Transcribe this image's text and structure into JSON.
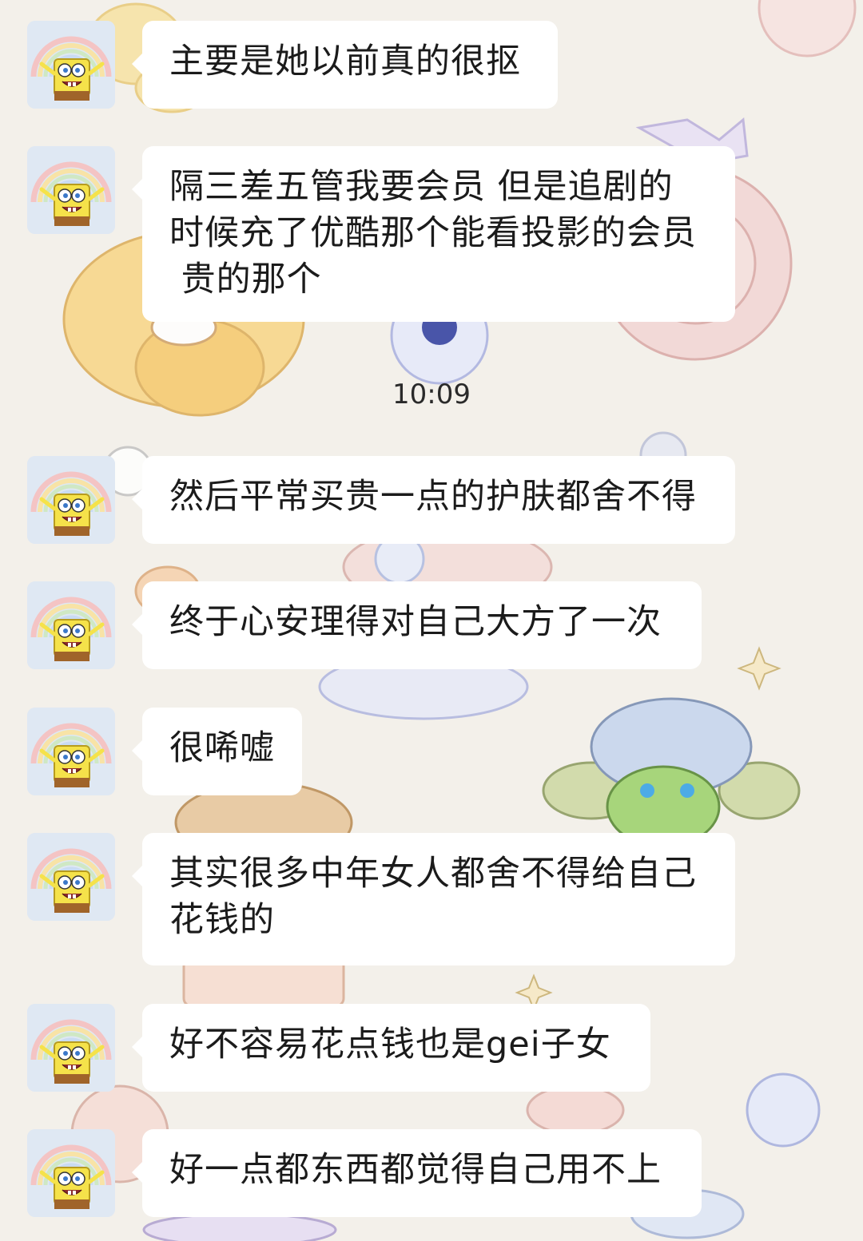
{
  "chat": {
    "timestamp": "10:09",
    "messages": [
      {
        "text": "主要是她以前真的很抠",
        "avatar": "spongebob-avatar"
      },
      {
        "text": "隔三差五管我要会员 但是追剧的\n时候充了优酷那个能看投影的会员\n 贵的那个",
        "avatar": "spongebob-avatar"
      },
      {
        "text": "然后平常买贵一点的护肤都舍不得",
        "avatar": "spongebob-avatar"
      },
      {
        "text": "终于心安理得对自己大方了一次",
        "avatar": "spongebob-avatar"
      },
      {
        "text": "很唏嘘",
        "avatar": "spongebob-avatar"
      },
      {
        "text": "其实很多中年女人都舍不得给自己\n花钱的",
        "avatar": "spongebob-avatar"
      },
      {
        "text": "好不容易花点钱也是gei子女",
        "avatar": "spongebob-avatar"
      },
      {
        "text": "好一点都东西都觉得自己用不上",
        "avatar": "spongebob-avatar"
      }
    ]
  },
  "colors": {
    "background": "#f3f0ea",
    "bubble": "#ffffff",
    "text": "#1b1b1b"
  }
}
